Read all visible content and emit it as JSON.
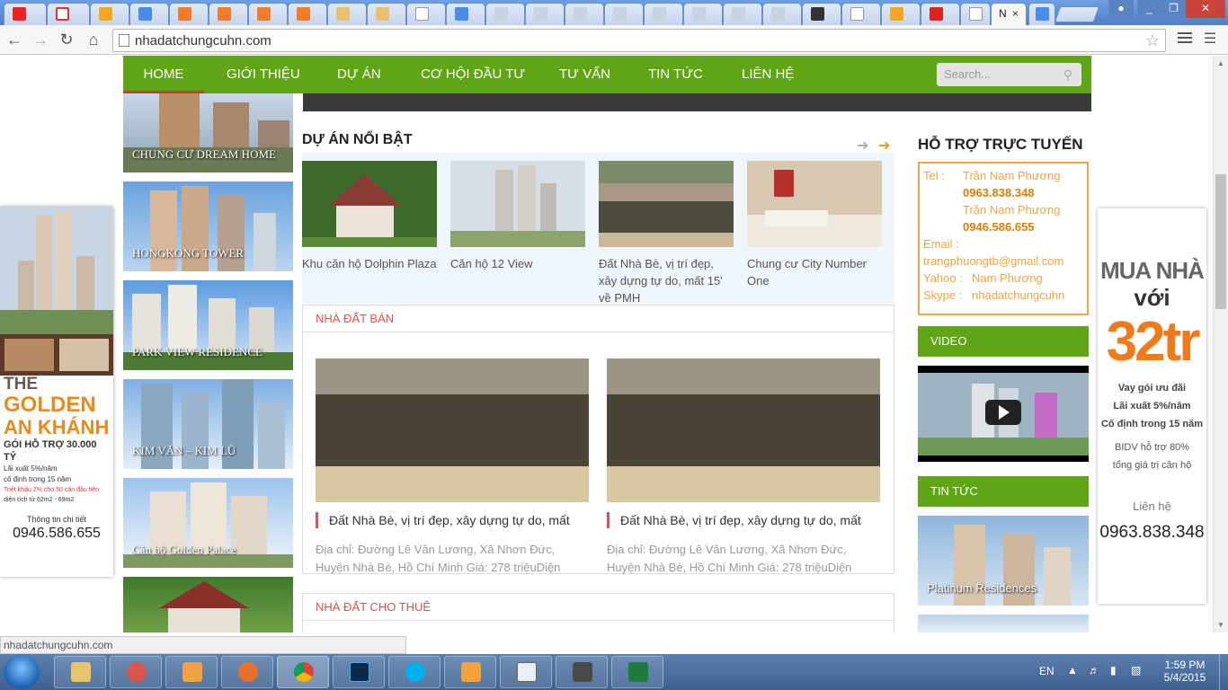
{
  "browser": {
    "active_tab_title": "N",
    "tab_close": "×",
    "url": "nhadatchungcuhn.com",
    "status_url": "nhadatchungcuhn.com",
    "window_buttons": [
      "_",
      "❐",
      "✕"
    ]
  },
  "nav": {
    "items": [
      "HOME",
      "GIỚI THIỆU",
      "DỰ ÁN",
      "CƠ HỘI ĐẦU TƯ",
      "TƯ VẤN",
      "TIN TỨC",
      "LIÊN HỆ"
    ],
    "search_placeholder": "Search..."
  },
  "left_projects": [
    "CHUNG CƯ DREAM HOME",
    "HONGKONG TOWER",
    "PARK VIEW RESIDENCE",
    "KIM VĂN – KIM LŨ",
    "Căn hộ Golden Palace",
    ""
  ],
  "left_ad": {
    "l1": "THE",
    "l2": "GOLDEN",
    "l3": "AN KHÁNH",
    "l4": "GÓI HỖ TRỢ 30.000 TỶ",
    "l5": "Lãi xuất 5%/năm",
    "l6": "cố định trong 15 năm",
    "l7": "Triết khấu 2% cho 50 căn đầu tiên",
    "l8": "diện tích từ 62m2 - 69m2",
    "l9": "Thông tin chi tiết",
    "phone": "0946.586.655"
  },
  "featured": {
    "title": "DỰ ÁN NỔI BẬT",
    "items": [
      "Khu căn hộ Dolphin Plaza",
      "Căn hộ 12 View",
      "Đất Nhà Bè, vị trí đẹp, xây dựng tự do, mất 15' về PMH",
      "Chung cư City Number One"
    ]
  },
  "sale": {
    "title": "NHÀ ĐẤT BÁN",
    "items": [
      {
        "title": "Đất Nhà Bè, vị trí đẹp, xây dựng tự do, mất",
        "desc": "Địa chỉ: Đường Lê Văn Lương, Xã Nhơn Đức, Huyện Nhà Bè, Hồ Chí Minh Giá: 278 triệuDiện"
      },
      {
        "title": "Đất Nhà Bè, vị trí đẹp, xây dựng tự do, mất",
        "desc": "Địa chỉ: Đường Lê Văn Lương, Xã Nhơn Đức, Huyện Nhà Bè, Hồ Chí Minh Giá: 278 triệuDiện"
      }
    ]
  },
  "rent": {
    "title": "NHÀ ĐẤT CHO THUÊ"
  },
  "support": {
    "title": "HỖ TRỢ TRỰC TUYẾN",
    "tel_label": "Tel :",
    "name1": "Trần Nam Phương",
    "phone1": "0963.838.348",
    "name2": "Trần Nam Phương",
    "phone2": "0946.586.655",
    "email_label": "Email :",
    "email": "trangphuongtb@gmail.com",
    "yahoo_label": "Yahoo :",
    "yahoo": "Nam Phương",
    "skype_label": "Skype :",
    "skype": "nhadatchungcuhn"
  },
  "video": {
    "title": "VIDEO"
  },
  "news": {
    "title": "TIN TỨC",
    "item": "Platinum Residences"
  },
  "right_ad": {
    "l1": "MUA NHÀ",
    "l2": "với",
    "l3": "32tr",
    "l4": "Vay gói ưu đãi",
    "l5": "Lãi xuất 5%/năm",
    "l6": "Cố định trong 15 năm",
    "l7": "BIDV hỗ trợ 80%",
    "l8": "tổng giá trị căn hộ",
    "l9": "Liên hệ",
    "phone": "0963.838.348"
  },
  "tray": {
    "lang": "EN",
    "time": "1:59 PM",
    "date": "5/4/2015"
  },
  "colors": {
    "nav_green": "#5fa516",
    "accent_red": "#d9534f",
    "support_orange": "#f0a342"
  }
}
